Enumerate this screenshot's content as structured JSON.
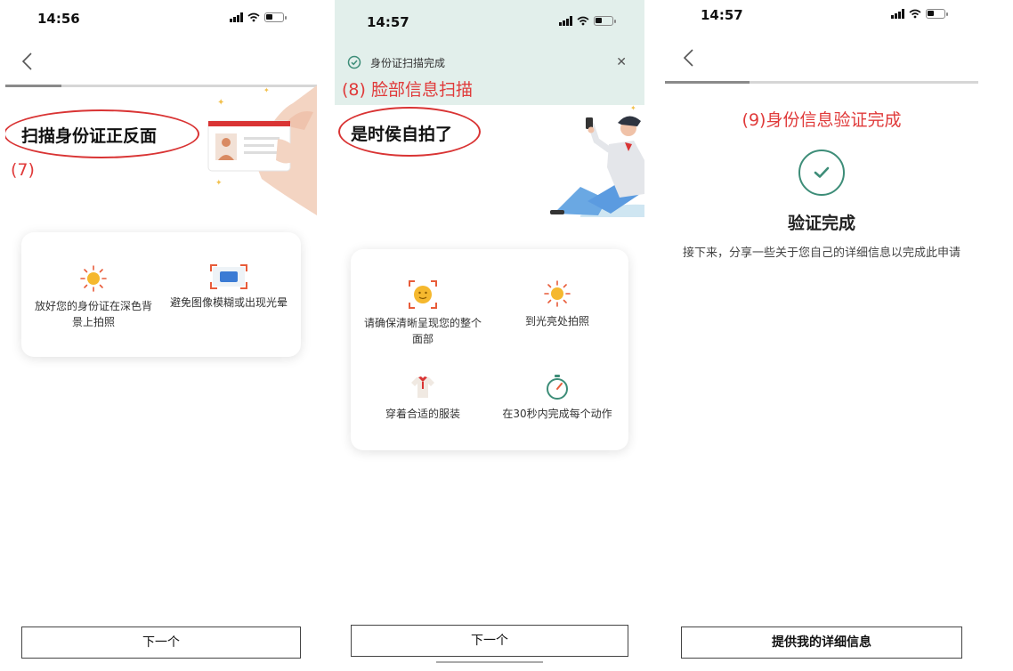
{
  "screens": [
    {
      "time": "14:56",
      "annotation_number": "(7)",
      "title": "扫描身份证正反面",
      "tips": [
        {
          "label": "放好您的身份证在深色背景上拍照",
          "icon": "sun-icon"
        },
        {
          "label": "避免图像模糊或出现光晕",
          "icon": "scan-frame-icon"
        }
      ],
      "next_button": "下一个",
      "progress": 0.18
    },
    {
      "time": "14:57",
      "banner_text": "身份证扫描完成",
      "annotation": "(8) 脸部信息扫描",
      "title": "是时侯自拍了",
      "tips": [
        {
          "label": "请确保清晰呈现您的整个面部",
          "icon": "face-icon"
        },
        {
          "label": "到光亮处拍照",
          "icon": "sun-icon"
        },
        {
          "label": "穿着合适的服装",
          "icon": "shirt-icon"
        },
        {
          "label": "在30秒内完成每个动作",
          "icon": "stopwatch-icon"
        }
      ],
      "next_button": "下一个"
    },
    {
      "time": "14:57",
      "annotation": "(9)身份信息验证完成",
      "done_title": "验证完成",
      "done_desc": "接下来，分享一些关于您自己的详细信息以完成此申请",
      "provide_button": "提供我的详细信息",
      "progress": 0.27
    }
  ],
  "colors": {
    "annotation_red": "#e03a3a",
    "success_green": "#3d8d78",
    "banner_bg": "#e2efeb",
    "accent_sun": "#f5b82e"
  }
}
